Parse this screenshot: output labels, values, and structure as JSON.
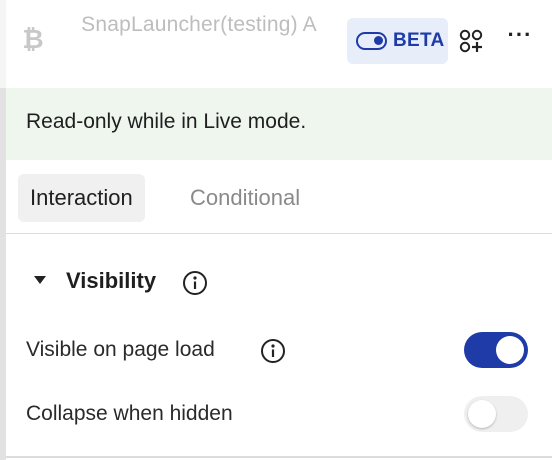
{
  "header": {
    "component_icon": "bitcoin-icon",
    "component_title": "SnapLauncher(testing) A",
    "beta_label": "BETA",
    "beta_icon": "toggle-icon",
    "apps_icon": "apps-plus-icon",
    "more_icon": "more-horizontal-icon",
    "accent_color": "#1f3ba8"
  },
  "banner": {
    "text": "Read-only while in Live mode.",
    "background": "#eef6ee"
  },
  "tabs": [
    {
      "label": "Interaction",
      "active": true
    },
    {
      "label": "Conditional",
      "active": false
    }
  ],
  "visibility": {
    "title": "Visibility",
    "expanded": true,
    "info_icon": "info-icon",
    "rows": [
      {
        "label": "Visible on page load",
        "enabled": true,
        "has_info": true
      },
      {
        "label": "Collapse when hidden",
        "enabled": false,
        "has_info": false
      }
    ]
  }
}
